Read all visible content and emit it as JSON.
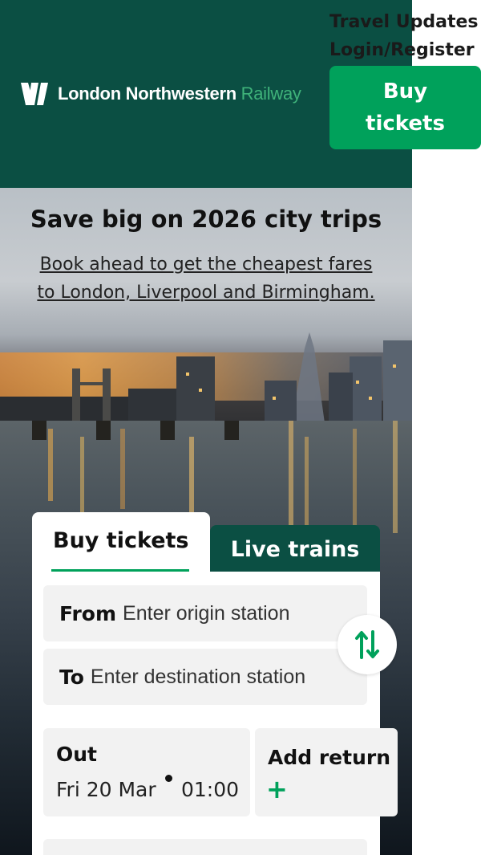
{
  "header": {
    "brand_main": "London Northwestern",
    "brand_accent": "Railway",
    "links": {
      "travel_updates": "Travel Updates",
      "login_register": "Login/Register"
    },
    "buy_tickets_label": "Buy tickets"
  },
  "hero": {
    "title": "Save big on 2026 city trips",
    "subtitle": "Book ahead to get the cheapest fares to London, Liverpool and Birmingham."
  },
  "widget": {
    "tabs": {
      "buy": "Buy tickets",
      "live": "Live trains"
    },
    "from": {
      "label": "From",
      "placeholder": "Enter origin station"
    },
    "to": {
      "label": "To",
      "placeholder": "Enter destination station"
    },
    "out": {
      "label": "Out",
      "date": "Fri 20 Mar",
      "time": "01:00"
    },
    "return": {
      "label": "Add return",
      "icon": "+"
    }
  },
  "colors": {
    "brand_dark_green": "#0b4f43",
    "accent_green": "#00a15b",
    "field_bg": "#f2f2f2"
  },
  "icons": {
    "logo": "lnr-logo-icon",
    "swap": "swap-arrows-icon"
  }
}
